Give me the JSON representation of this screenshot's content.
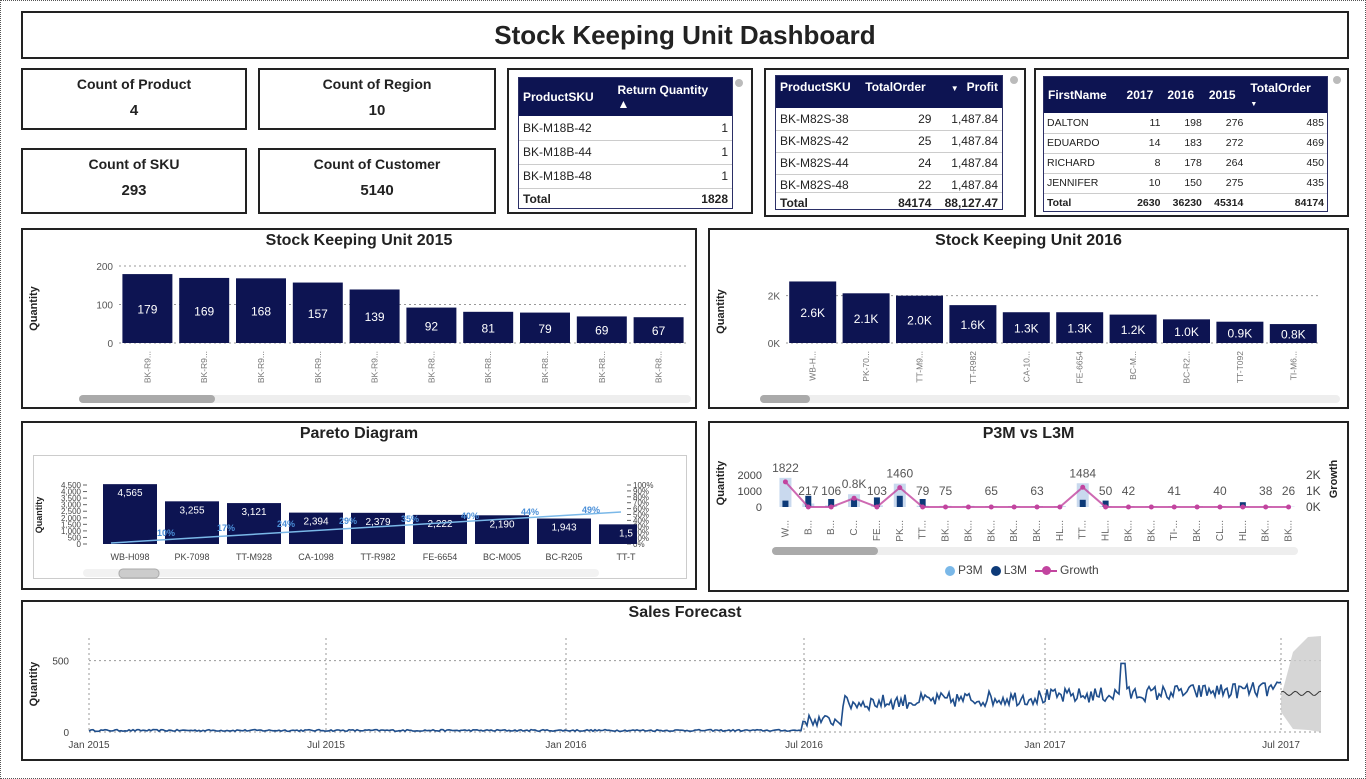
{
  "title": "Stock Keeping Unit Dashboard",
  "cards": [
    {
      "label": "Count of Product",
      "value": "4"
    },
    {
      "label": "Count of Region",
      "value": "10"
    },
    {
      "label": "Count of SKU",
      "value": "293"
    },
    {
      "label": "Count of Customer",
      "value": "5140"
    }
  ],
  "returns_table": {
    "headers": [
      "ProductSKU",
      "Return Quantity"
    ],
    "rows": [
      [
        "BK-M18B-42",
        "1"
      ],
      [
        "BK-M18B-44",
        "1"
      ],
      [
        "BK-M18B-48",
        "1"
      ]
    ],
    "total_label": "Total",
    "total_value": "1828"
  },
  "profit_table": {
    "headers": [
      "ProductSKU",
      "TotalOrder",
      "Profit"
    ],
    "rows": [
      [
        "BK-M82S-38",
        "29",
        "1,487.84"
      ],
      [
        "BK-M82S-42",
        "25",
        "1,487.84"
      ],
      [
        "BK-M82S-44",
        "24",
        "1,487.84"
      ],
      [
        "BK-M82S-48",
        "22",
        "1,487.84"
      ]
    ],
    "total": [
      "Total",
      "84174",
      "88,127.47"
    ]
  },
  "customer_table": {
    "headers": [
      "FirstName",
      "2017",
      "2016",
      "2015",
      "TotalOrder"
    ],
    "rows": [
      [
        "DALTON",
        "11",
        "198",
        "276",
        "485"
      ],
      [
        "EDUARDO",
        "14",
        "183",
        "272",
        "469"
      ],
      [
        "RICHARD",
        "8",
        "178",
        "264",
        "450"
      ],
      [
        "JENNIFER",
        "10",
        "150",
        "275",
        "435"
      ]
    ],
    "total": [
      "Total",
      "2630",
      "36230",
      "45314",
      "84174"
    ]
  },
  "colors": {
    "navy": "#0d1452",
    "line": "#1f4e8c",
    "light": "#7ab8e8",
    "pink": "#c2449f"
  },
  "chart_data": [
    {
      "id": "sku2015",
      "type": "bar",
      "title": "Stock Keeping Unit 2015",
      "ylabel": "Quantity",
      "ylim": [
        0,
        200
      ],
      "yticks": [
        "0",
        "100",
        "200"
      ],
      "categories": [
        "BK-R9...",
        "BK-R9...",
        "BK-R9...",
        "BK-R9...",
        "BK-R9...",
        "BK-R8...",
        "BK-R8...",
        "BK-R8...",
        "BK-R8...",
        "BK-R8..."
      ],
      "values": [
        179,
        169,
        168,
        157,
        139,
        92,
        81,
        79,
        69,
        67
      ],
      "labels": [
        "179",
        "169",
        "168",
        "157",
        "139",
        "92",
        "81",
        "79",
        "69",
        "67"
      ]
    },
    {
      "id": "sku2016",
      "type": "bar",
      "title": "Stock Keeping Unit 2016",
      "ylabel": "Quantity",
      "ylim": [
        0,
        3000
      ],
      "yticks": [
        "0K",
        "2K"
      ],
      "categories": [
        "WB-H...",
        "PK-70...",
        "TT-M9...",
        "TT-R982",
        "CA-10...",
        "FE-6654",
        "BC-M...",
        "BC-R2...",
        "TT-T092",
        "TI-M6..."
      ],
      "values": [
        2600,
        2100,
        2000,
        1600,
        1300,
        1300,
        1200,
        1000,
        900,
        800
      ],
      "labels": [
        "2.6K",
        "2.1K",
        "2.0K",
        "1.6K",
        "1.3K",
        "1.3K",
        "1.2K",
        "1.0K",
        "0.9K",
        "0.8K"
      ]
    },
    {
      "id": "pareto",
      "type": "bar",
      "title": "Pareto Diagram",
      "ylabel": "Quantity",
      "ylim": [
        0,
        4500
      ],
      "yticks": [
        "0",
        "500",
        "1,000",
        "1,500",
        "2,000",
        "2,500",
        "3,000",
        "3,500",
        "4,000",
        "4,500"
      ],
      "y2ticks": [
        "0%",
        "10%",
        "20%",
        "30%",
        "40%",
        "50%",
        "60%",
        "70%",
        "80%",
        "90%",
        "100%"
      ],
      "categories": [
        "WB-H098",
        "PK-7098",
        "TT-M928",
        "CA-1098",
        "TT-R982",
        "FE-6654",
        "BC-M005",
        "BC-R205",
        "TT-T"
      ],
      "values": [
        4565,
        3255,
        3121,
        2394,
        2379,
        2222,
        2190,
        1943,
        1500
      ],
      "labels": [
        "4,565",
        "3,255",
        "3,121",
        "2,394",
        "2,379",
        "2,222",
        "2,190",
        "1,943",
        "1,5"
      ],
      "cumulative_pct": [
        "10%",
        "17%",
        "24%",
        "29%",
        "35%",
        "40%",
        "44%",
        "49%"
      ]
    },
    {
      "id": "p3m",
      "type": "bar",
      "title": "P3M vs L3M",
      "ylabel": "Quantity",
      "y2label": "Growth",
      "yticks": [
        "0",
        "1000",
        "2000"
      ],
      "y2ticks": [
        "0K",
        "1K",
        "2K"
      ],
      "categories": [
        "W...",
        "B...",
        "B...",
        "C...",
        "FE...",
        "PK...",
        "TT...",
        "BK...",
        "BK...",
        "BK...",
        "BK...",
        "BK...",
        "HL...",
        "TT...",
        "HL...",
        "BK...",
        "BK...",
        "TI-...",
        "BK...",
        "CL...",
        "HL...",
        "BK...",
        "BK..."
      ],
      "p3m": [
        1822,
        217,
        106,
        800,
        103,
        1460,
        79,
        75,
        75,
        65,
        65,
        63,
        63,
        1484,
        50,
        42,
        42,
        41,
        41,
        40,
        40,
        38,
        26
      ],
      "l3m": [
        400,
        700,
        500,
        500,
        600,
        700,
        500,
        0,
        0,
        0,
        0,
        0,
        0,
        450,
        400,
        0,
        0,
        0,
        0,
        0,
        300,
        0,
        0
      ],
      "data_labels": [
        "1822",
        "217",
        "106",
        "0.8K",
        "103",
        "1460",
        "79",
        "75",
        "",
        "65",
        "",
        "63",
        "",
        "1484",
        "50",
        "42",
        "",
        "41",
        "",
        "40",
        "",
        "38",
        "26"
      ],
      "legend": [
        "P3M",
        "L3M",
        "Growth"
      ]
    },
    {
      "id": "forecast",
      "type": "line",
      "title": "Sales Forecast",
      "ylabel": "Quantity",
      "yticks": [
        "0",
        "500"
      ],
      "xticks": [
        "Jan 2015",
        "Jul 2015",
        "Jan 2016",
        "Jul 2016",
        "Jan 2017",
        "Jul 2017"
      ],
      "ylim": [
        0,
        700
      ]
    }
  ]
}
